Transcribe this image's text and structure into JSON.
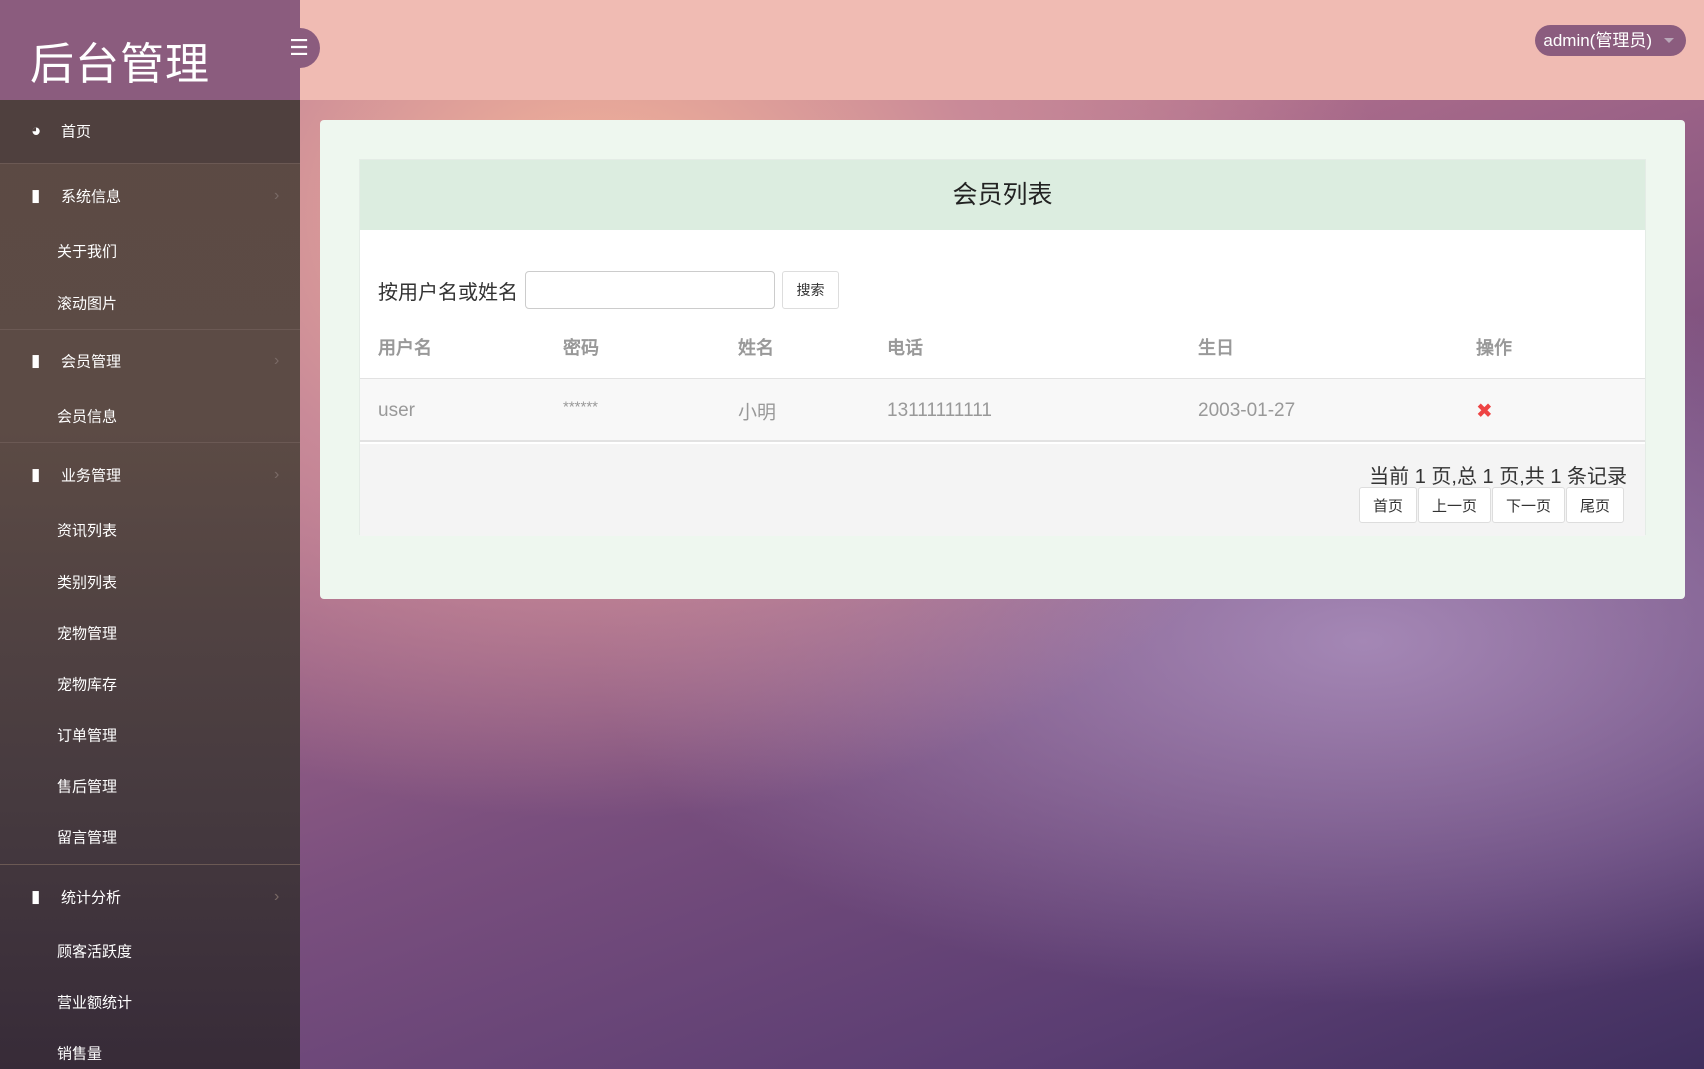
{
  "app": {
    "title": "后台管理",
    "user_menu": "admin(管理员)"
  },
  "sidebar": {
    "items": [
      {
        "type": "home",
        "label": "首页",
        "icon": "dashboard-icon"
      },
      {
        "type": "group",
        "label": "系统信息",
        "icon": "book-icon"
      },
      {
        "type": "sub",
        "label": "关于我们"
      },
      {
        "type": "sub",
        "label": "滚动图片"
      },
      {
        "type": "group",
        "label": "会员管理",
        "icon": "book-icon"
      },
      {
        "type": "sub",
        "label": "会员信息"
      },
      {
        "type": "group",
        "label": "业务管理",
        "icon": "book-icon"
      },
      {
        "type": "sub",
        "label": "资讯列表"
      },
      {
        "type": "sub",
        "label": "类别列表"
      },
      {
        "type": "sub",
        "label": "宠物管理"
      },
      {
        "type": "sub",
        "label": "宠物库存"
      },
      {
        "type": "sub",
        "label": "订单管理"
      },
      {
        "type": "sub",
        "label": "售后管理"
      },
      {
        "type": "sub",
        "label": "留言管理"
      },
      {
        "type": "group",
        "label": "统计分析",
        "icon": "book-icon"
      },
      {
        "type": "sub",
        "label": "顾客活跃度"
      },
      {
        "type": "sub",
        "label": "营业额统计"
      },
      {
        "type": "sub",
        "label": "销售量"
      }
    ]
  },
  "main": {
    "title": "会员列表",
    "search": {
      "label": "按用户名或姓名",
      "value": "",
      "button": "搜索"
    },
    "columns": [
      "用户名",
      "密码",
      "姓名",
      "电话",
      "生日",
      "操作"
    ],
    "rows": [
      {
        "username": "user",
        "password": "******",
        "name": "小明",
        "phone": "13111111111",
        "birthday": "2003-01-27"
      }
    ],
    "pagination": {
      "info": "当前 1 页,总 1 页,共 1 条记录",
      "first": "首页",
      "prev": "上一页",
      "next": "下一页",
      "last": "尾页"
    }
  }
}
